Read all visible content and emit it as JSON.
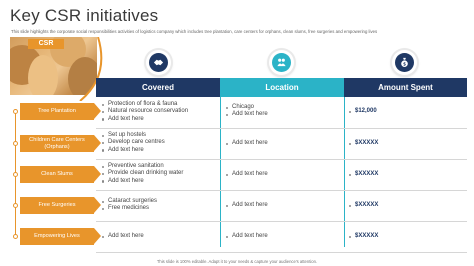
{
  "page": {
    "title": "Key CSR initiatives",
    "subtitle": "This slide highlights the corporate social responsibilities activities of logistics company which includes tree plantation, care centers for orphans, clean slums, free surgeries and empowering lives",
    "footer": "This slide is 100% editable. Adapt it to your needs & capture your audience's attention."
  },
  "csr_label": "CSR",
  "categories": [
    {
      "label": "Tree Plantation"
    },
    {
      "label": "Children Care Centers (Orphans)"
    },
    {
      "label": "Clean Slums"
    },
    {
      "label": "Free Surgeries"
    },
    {
      "label": "Empowering Lives"
    }
  ],
  "columns": [
    {
      "label": "Covered",
      "icon": "handshake-icon",
      "color": "#1f3864"
    },
    {
      "label": "Location",
      "icon": "people-icon",
      "color": "#2bb3c7"
    },
    {
      "label": "Amount Spent",
      "icon": "money-bag-icon",
      "color": "#1f3864"
    }
  ],
  "rows": [
    {
      "covered": [
        "Protection of flora & fauna",
        "Natural resource conservation",
        "Add text here"
      ],
      "location": "Chicago",
      "location2": "Add text here",
      "amount": "$12,000"
    },
    {
      "covered": [
        "Set up hostels",
        "Develop care centres",
        "Add text here"
      ],
      "location": "Add text here",
      "location2": "",
      "amount": "$XXXXX"
    },
    {
      "covered": [
        "Preventive sanitation",
        "Provide clean drinking water",
        "Add text here"
      ],
      "location": "Add text here",
      "location2": "",
      "amount": "$XXXXX"
    },
    {
      "covered": [
        "Cataract surgeries",
        "Free medicines"
      ],
      "location": "Add text here",
      "location2": "",
      "amount": "$XXXXX"
    },
    {
      "covered": [
        "Add text here"
      ],
      "location": "Add text here",
      "location2": "",
      "amount": "$XXXXX"
    }
  ],
  "colors": {
    "orange": "#e8952b",
    "navy": "#1f3864",
    "teal": "#2bb3c7"
  }
}
